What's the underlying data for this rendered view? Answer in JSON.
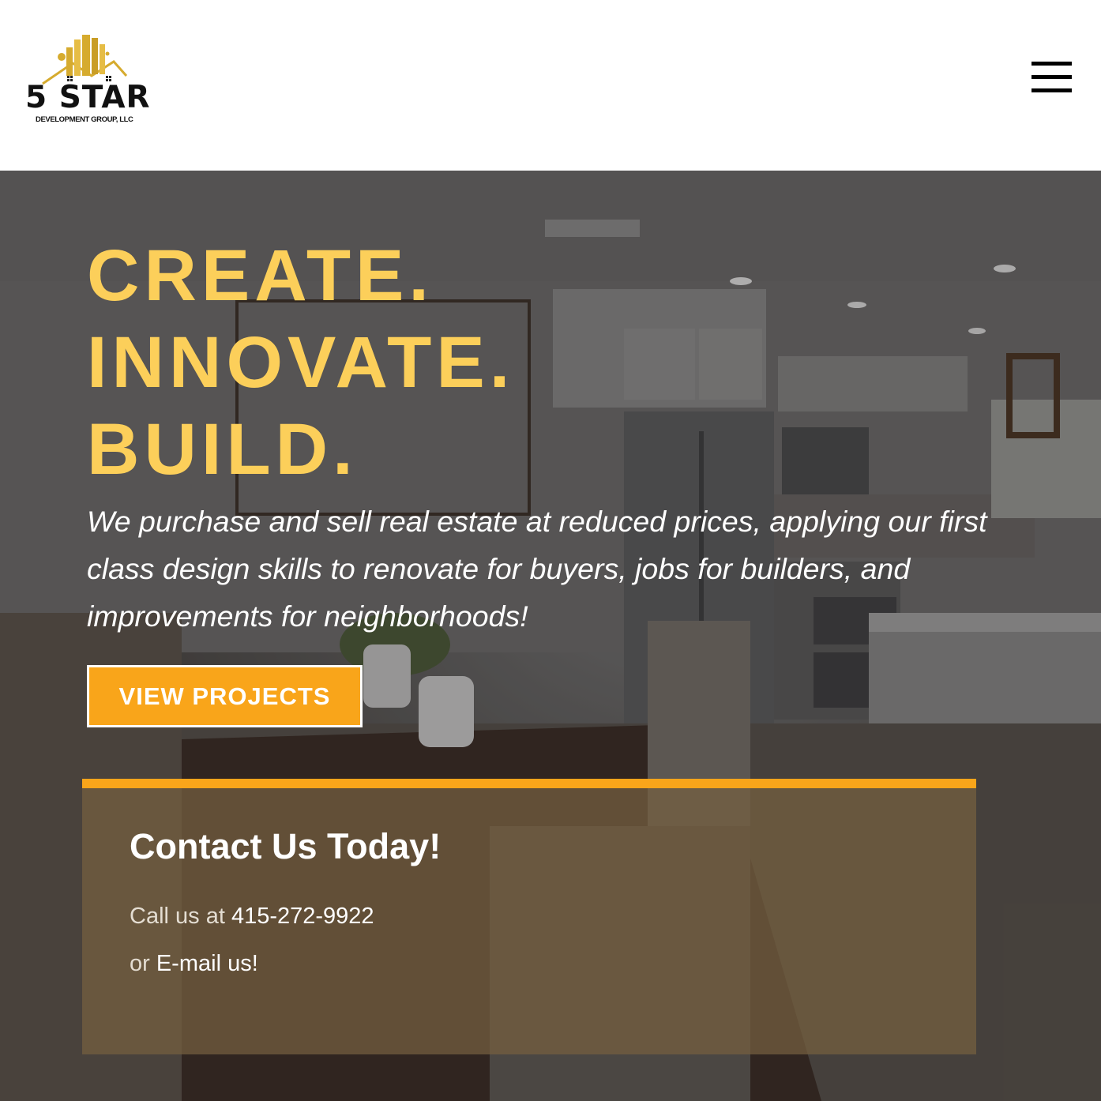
{
  "header": {
    "logo_title": "5 STAR",
    "logo_subtitle": "DEVELOPMENT GROUP, LLC",
    "menu_icon": "hamburger-menu-icon"
  },
  "hero": {
    "headline": [
      "CREATE.",
      "INNOVATE.",
      "BUILD."
    ],
    "tagline": "We purchase and sell real estate at reduced prices, applying our first class design skills to renovate for buyers, jobs for builders, and improvements for neighborhoods!",
    "cta_label": "VIEW PROJECTS"
  },
  "contact": {
    "title": "Contact Us Today!",
    "call_prefix": "Call us at ",
    "phone": "415-272-9922",
    "email_prefix": "or ",
    "email_label": "E-mail us!"
  },
  "colors": {
    "headline": "#fccf5a",
    "accent_orange": "#f9a51a",
    "logo_gold": "#d6ab2e",
    "card_overlay": "#765f40"
  }
}
